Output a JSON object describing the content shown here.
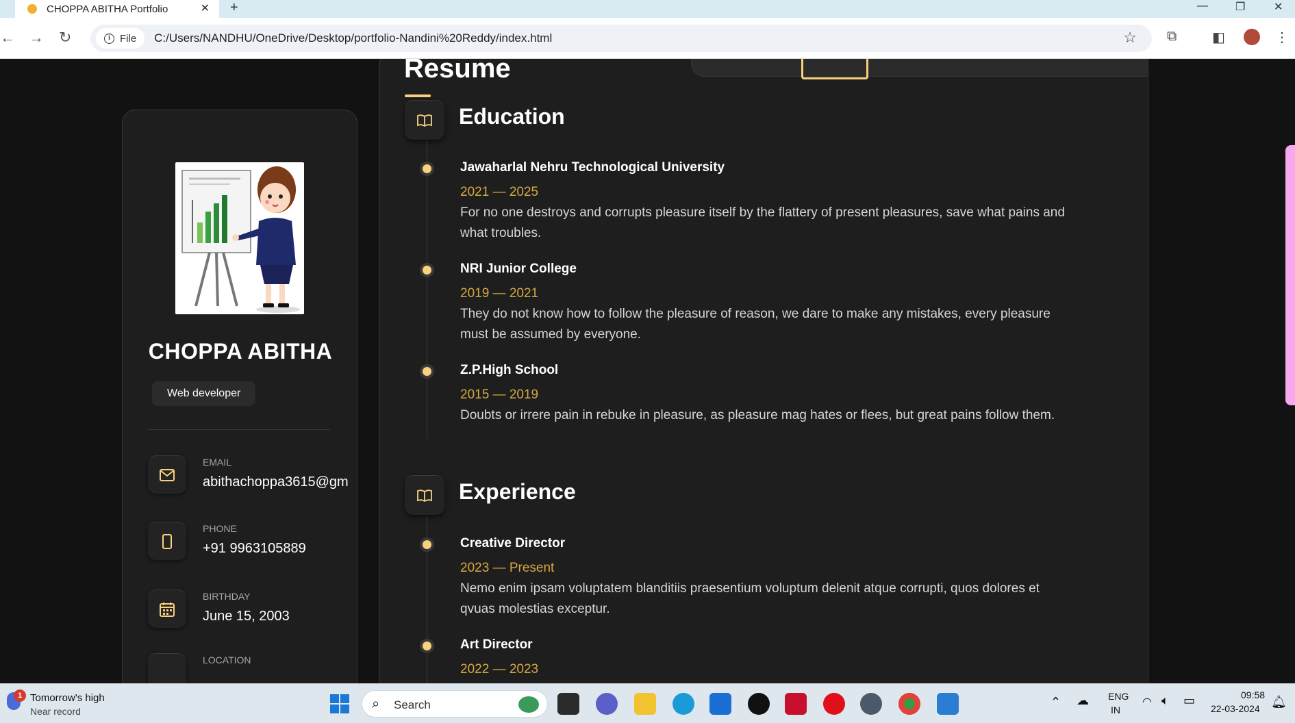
{
  "browser": {
    "tab_title": "CHOPPA ABITHA Portfolio",
    "tab_close": "✕",
    "new_tab": "+",
    "file_chip": "File",
    "url": "C:/Users/NANDHU/OneDrive/Desktop/portfolio-Nandini%20Reddy/index.html"
  },
  "sidebar": {
    "name": "CHOPPA ABITHA",
    "role": "Web developer",
    "contacts": [
      {
        "label": "EMAIL",
        "value": "abithachoppa3615@gm",
        "icon": "mail-icon"
      },
      {
        "label": "PHONE",
        "value": "+91 9963105889",
        "icon": "phone-icon"
      },
      {
        "label": "BIRTHDAY",
        "value": "June 15, 2003",
        "icon": "calendar-icon"
      },
      {
        "label": "LOCATION",
        "value": "",
        "icon": "location-icon"
      }
    ]
  },
  "resume": {
    "title": "Resume",
    "education": {
      "title": "Education",
      "items": [
        {
          "title": "Jawaharlal Nehru Technological University",
          "date": "2021 — 2025",
          "text": "For no one destroys and corrupts pleasure itself by the flattery of present pleasures, save what pains and what troubles."
        },
        {
          "title": "NRI Junior College",
          "date": "2019 — 2021",
          "text": "They do not know how to follow the pleasure of reason, we dare to make any mistakes, every pleasure must be assumed by everyone."
        },
        {
          "title": "Z.P.High School",
          "date": "2015 — 2019",
          "text": "Doubts or irrere pain in rebuke in pleasure, as pleasure mag hates or flees, but great pains follow them."
        }
      ]
    },
    "experience": {
      "title": "Experience",
      "items": [
        {
          "title": "Creative Director",
          "date": "2023 — Present",
          "text": "Nemo enim ipsam voluptatem blanditiis praesentium voluptum delenit atque corrupti, quos dolores et qvuas molestias exceptur."
        },
        {
          "title": "Art Director",
          "date": "2022 — 2023",
          "text": ""
        }
      ]
    }
  },
  "taskbar": {
    "weather_badge": "1",
    "weather_title": "Tomorrow's high",
    "weather_sub": "Near record",
    "search_label": "Search",
    "lang_1": "ENG",
    "lang_2": "IN",
    "time": "09:58",
    "date": "22-03-2024"
  },
  "colors": {
    "accent": "#fad17d",
    "date": "#d6a93f",
    "panel": "#1e1e1f"
  }
}
